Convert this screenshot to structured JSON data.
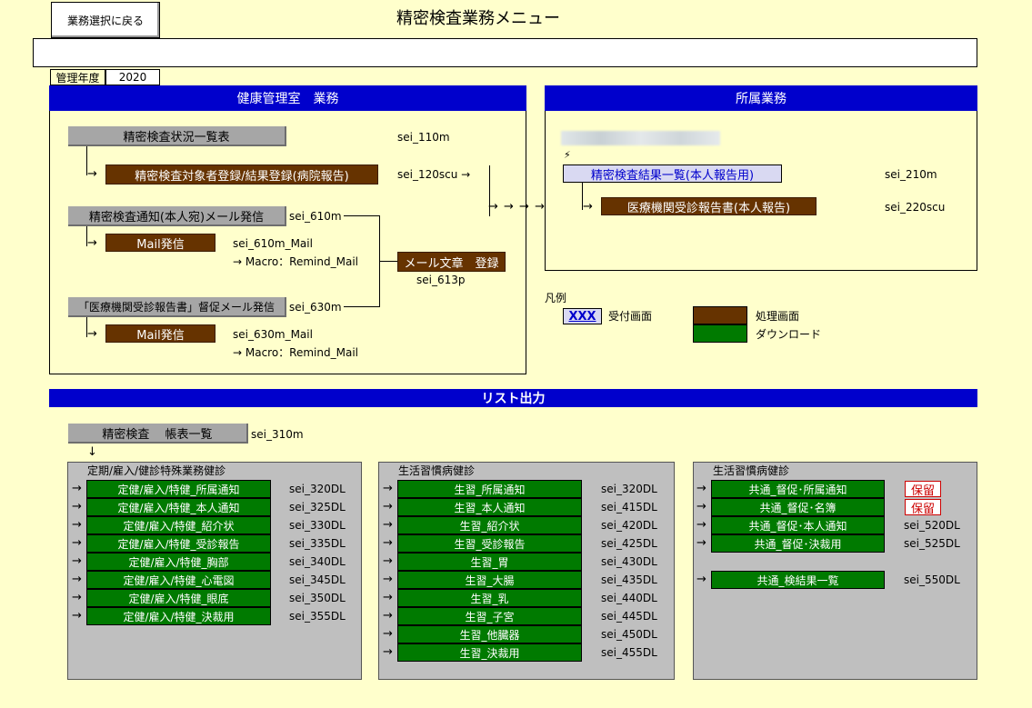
{
  "header": {
    "back_button": "業務選択に戻る",
    "title": "精密検査業務メニュー",
    "message": "",
    "year_label": "管理年度",
    "year_value": "2020"
  },
  "health_office": {
    "title": "健康管理室　業務",
    "status_list_button": "精密検査状況一覧表",
    "status_list_code": "sei_110m",
    "target_register_button": "精密検査対象者登録/結果登録(病院報告)",
    "target_register_code": "sei_120scu →",
    "notice_mail_button": "精密検査通知(本人宛)メール発信",
    "notice_mail_code": "sei_610m",
    "mail_send_1": "Mail発信",
    "mail_send_1_code": "sei_610m_Mail",
    "mail_send_1_macro": "→  Macro：Remind_Mail",
    "mail_text_button": "メール文章　登録",
    "mail_text_code": "sei_613p",
    "remind_mail_button": "「医療機関受診報告書」督促メール発信",
    "remind_mail_code": "sei_630m",
    "mail_send_2": "Mail発信",
    "mail_send_2_code": "sei_630m_Mail",
    "mail_send_2_macro": "→  Macro：Remind_Mail",
    "flow_arrows": "→ → → → →"
  },
  "affiliate": {
    "title": "所属業務",
    "lightning": "⚡",
    "result_list_button": "精密検査結果一覧(本人報告用)",
    "result_list_code": "sei_210m",
    "clinic_report_button": "医療機関受診報告書(本人報告)",
    "clinic_report_code": "sei_220scu"
  },
  "legend": {
    "title": "凡例",
    "sample": "XXX",
    "reception": "受付画面",
    "processing": "処理画面",
    "download": "ダウンロード"
  },
  "list_output": {
    "title": "リスト出力",
    "ledger_button": "精密検査　 帳表一覧",
    "ledger_code": "sei_310m",
    "down_arrow": "↓",
    "arrow": "→",
    "groups": [
      {
        "title": "定期/雇入/健診特殊業務健診",
        "items": [
          {
            "label": "定健/雇入/特健_所属通知",
            "code": "sei_320DL"
          },
          {
            "label": "定健/雇入/特健_本人通知",
            "code": "sei_325DL"
          },
          {
            "label": "定健/雇入/特健_紹介状",
            "code": "sei_330DL"
          },
          {
            "label": "定健/雇入/特健_受診報告",
            "code": "sei_335DL"
          },
          {
            "label": "定健/雇入/特健_胸部",
            "code": "sei_340DL"
          },
          {
            "label": "定健/雇入/特健_心電図",
            "code": "sei_345DL"
          },
          {
            "label": "定健/雇入/特健_眼底",
            "code": "sei_350DL"
          },
          {
            "label": "定健/雇入/特健_決裁用",
            "code": "sei_355DL"
          }
        ]
      },
      {
        "title": "生活習慣病健診",
        "items": [
          {
            "label": "生習_所属通知",
            "code": "sei_320DL"
          },
          {
            "label": "生習_本人通知",
            "code": "sei_415DL"
          },
          {
            "label": "生習_紹介状",
            "code": "sei_420DL"
          },
          {
            "label": "生習_受診報告",
            "code": "sei_425DL"
          },
          {
            "label": "生習_胃",
            "code": "sei_430DL"
          },
          {
            "label": "生習_大腸",
            "code": "sei_435DL"
          },
          {
            "label": "生習_乳",
            "code": "sei_440DL"
          },
          {
            "label": "生習_子宮",
            "code": "sei_445DL"
          },
          {
            "label": "生習_他臓器",
            "code": "sei_450DL"
          },
          {
            "label": "生習_決裁用",
            "code": "sei_455DL"
          }
        ]
      },
      {
        "title": "生活習慣病健診",
        "items": [
          {
            "label": "共通_督促･所属通知",
            "code": "",
            "hold": "保留"
          },
          {
            "label": "共通_督促･名簿",
            "code": "",
            "hold": "保留"
          },
          {
            "label": "共通_督促･本人通知",
            "code": "sei_520DL"
          },
          {
            "label": "共通_督促･決裁用",
            "code": "sei_525DL"
          }
        ],
        "extra": {
          "label": "共通_検結果一覧",
          "code": "sei_550DL"
        }
      }
    ]
  },
  "colors": {
    "background": "#FFFFCC",
    "header_blue": "#0000CC",
    "processing_brown": "#663300",
    "download_green": "#007A00",
    "reception_lavender": "#D9D9F2"
  }
}
